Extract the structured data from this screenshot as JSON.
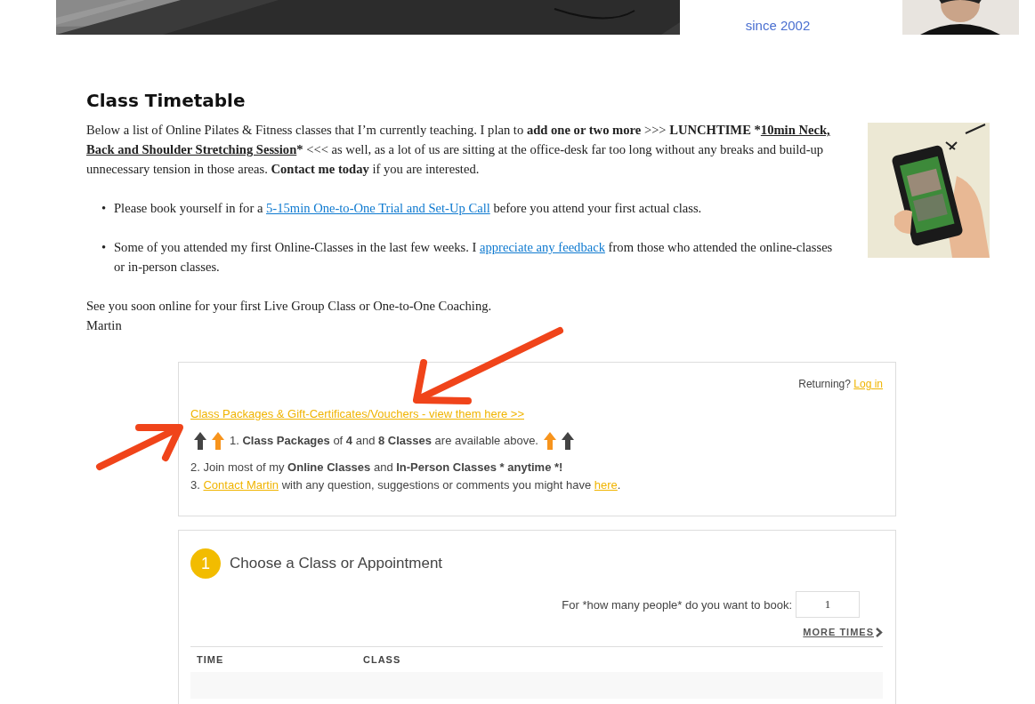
{
  "banner": {
    "since": "since 2002"
  },
  "heading": "Class Timetable",
  "intro": [
    {
      "kind": "plain",
      "text": "Below a list of Online Pilates & Fitness classes that I’m currently teaching. I plan to "
    },
    {
      "kind": "strong",
      "text": "add one or two more"
    },
    {
      "kind": "plain",
      "text": " >>> "
    },
    {
      "kind": "strong",
      "text": "LUNCHTIME *"
    },
    {
      "kind": "emphasis",
      "text": "10min Neck, Back and Shoulder Stretching Session"
    },
    {
      "kind": "strong",
      "text": "*"
    },
    {
      "kind": "plain",
      "text": " <<< as well, as a lot of us are sitting at the office-desk far too long without any breaks and build-up unnecessary tension in those areas. "
    },
    {
      "kind": "strong",
      "text": "Contact me today"
    },
    {
      "kind": "plain",
      "text": " if you are interested."
    }
  ],
  "bullets": [
    {
      "marker": "•",
      "before": "Please book yourself in for a ",
      "link": "5-15min One-to-One Trial and Set-Up Call",
      "after": " before you attend your first actual class."
    },
    {
      "marker": "•",
      "before": "Some of you attended my first Online-Classes in the last few weeks. I ",
      "link": "appreciate any feedback",
      "after": " from those who attended the online-classes or in-person classes."
    }
  ],
  "closing": [
    "See you soon online for your first Live Group Class or One-to-One Coaching.",
    "Martin"
  ],
  "booking": {
    "returning": "Returning?",
    "login": "Log in",
    "packages_link": "Class Packages & Gift-Certificates/Vouchers - view them here >>",
    "arrows_before": [
      {
        "color": "#444444"
      },
      {
        "color": "#f7941d"
      }
    ],
    "line1": "1. **Class Packages** of **4** and **8 Classes** are available above.",
    "arrows_after": [
      {
        "color": "#f7941d"
      },
      {
        "color": "#444444"
      }
    ],
    "line2": "2. Join most of my **Online Classes** and **In-Person Classes * anytime *!**",
    "line3": {
      "prefix": "3. ",
      "link": "Contact Martin",
      "middle": " with any question, suggestions or comments you might have ",
      "link2": "here",
      "suffix": "."
    }
  },
  "step": {
    "number": "1",
    "title": "Choose a Class or Appointment",
    "people_label": "For *how many people* do you want to book:",
    "people_value": "1",
    "more_times": "MORE TIMES",
    "columns": [
      "TIME",
      "CLASS"
    ]
  }
}
